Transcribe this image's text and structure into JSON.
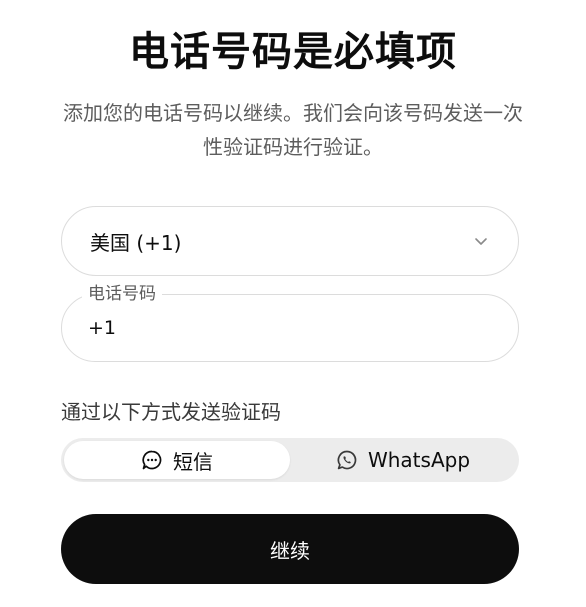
{
  "header": {
    "title": "电话号码是必填项",
    "subtitle": "添加您的电话号码以继续。我们会向该号码发送一次性验证码进行验证。"
  },
  "country": {
    "selected": "美国 (+1)",
    "icon": "chevron-down-icon"
  },
  "phone": {
    "label": "电话号码",
    "value": "+1"
  },
  "method": {
    "label": "通过以下方式发送验证码",
    "options": [
      {
        "label": "短信",
        "icon": "chat-bubble-icon",
        "active": true
      },
      {
        "label": "WhatsApp",
        "icon": "whatsapp-icon",
        "active": false
      }
    ]
  },
  "actions": {
    "continue_label": "继续"
  },
  "colors": {
    "primary_button": "#0d0d0d",
    "border": "#dcdcdc",
    "segment_bg": "#ececec"
  }
}
